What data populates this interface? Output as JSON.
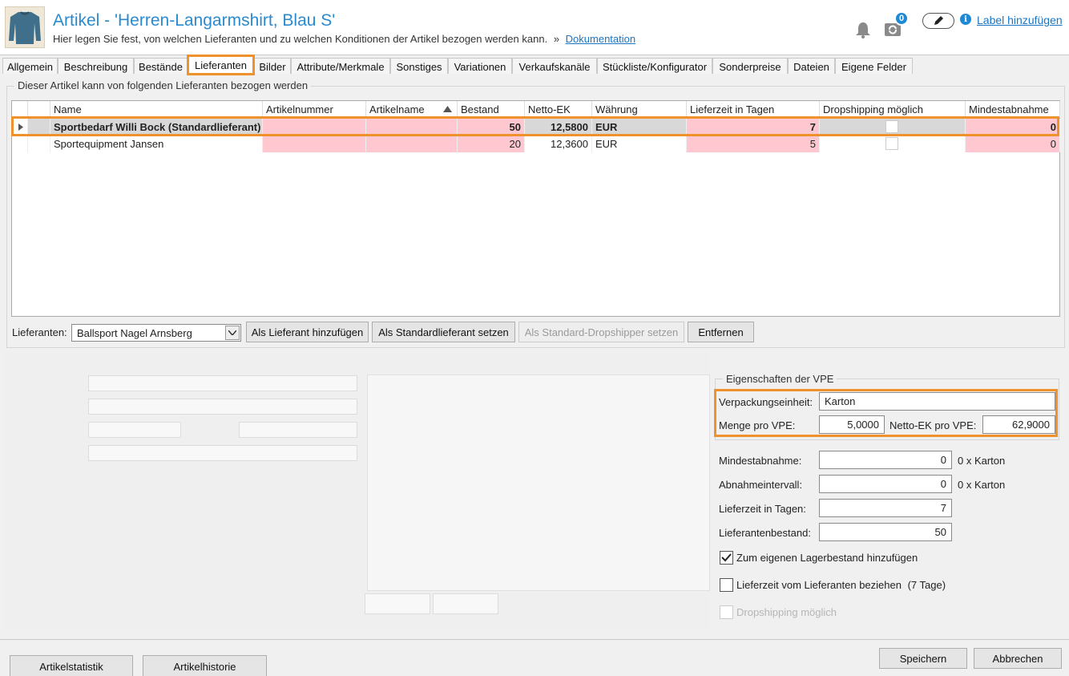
{
  "header": {
    "title": "Artikel - 'Herren-Langarmshirt, Blau S'",
    "subtitle": "Hier legen Sie fest, von welchen Lieferanten und zu welchen Konditionen der Artikel bezogen werden kann.",
    "separator": "»",
    "doc_link": "Dokumentation",
    "sync_count": "0",
    "label_link": "Label hinzufügen"
  },
  "tabs": [
    {
      "label": "Allgemein"
    },
    {
      "label": "Beschreibung"
    },
    {
      "label": "Bestände"
    },
    {
      "label": "Lieferanten"
    },
    {
      "label": "Bilder"
    },
    {
      "label": "Attribute/Merkmale"
    },
    {
      "label": "Sonstiges"
    },
    {
      "label": "Variationen"
    },
    {
      "label": "Verkaufskanäle"
    },
    {
      "label": "Stückliste/Konfigurator"
    },
    {
      "label": "Sonderpreise"
    },
    {
      "label": "Dateien"
    },
    {
      "label": "Eigene Felder"
    }
  ],
  "suppliers_group": {
    "title": "Dieser Artikel kann von folgenden Lieferanten bezogen werden",
    "columns": [
      "Name",
      "Artikelnummer",
      "Artikelname",
      "Bestand",
      "Netto-EK",
      "Währung",
      "Lieferzeit in Tagen",
      "Dropshipping möglich",
      "Mindestabnahme"
    ],
    "rows": [
      {
        "name": "Sportbedarf Willi Bock (Standardlieferant)",
        "artikelnummer": "",
        "artikelname": "",
        "bestand": "50",
        "netto_ek": "12,5800",
        "waehrung": "EUR",
        "lieferzeit": "7",
        "mindestabnahme": "0"
      },
      {
        "name": "Sportequipment Jansen",
        "artikelnummer": "",
        "artikelname": "",
        "bestand": "20",
        "netto_ek": "12,3600",
        "waehrung": "EUR",
        "lieferzeit": "5",
        "mindestabnahme": "0"
      }
    ],
    "supplier_label": "Lieferanten:",
    "supplier_selected": "Ballsport Nagel Arnsberg",
    "btn_add": "Als Lieferant hinzufügen",
    "btn_default": "Als Standardlieferant setzen",
    "btn_dropshipper": "Als Standard-Dropshipper setzen",
    "btn_remove": "Entfernen"
  },
  "vpe": {
    "title": "Eigenschaften der VPE",
    "unit_label": "Verpackungseinheit:",
    "unit_value": "Karton",
    "qty_label": "Menge pro VPE:",
    "qty_value": "5,0000",
    "ek_label": "Netto-EK pro VPE:",
    "ek_value": "62,9000"
  },
  "details": {
    "min_label": "Mindestabnahme:",
    "min_value": "0",
    "min_unit": "0 x Karton",
    "interval_label": "Abnahmeintervall:",
    "interval_value": "0",
    "interval_unit": "0 x Karton",
    "lead_label": "Lieferzeit in Tagen:",
    "lead_value": "7",
    "stock_label": "Lieferantenbestand:",
    "stock_value": "50",
    "chk_stock": "Zum eigenen Lagerbestand hinzufügen",
    "chk_stock_checked": true,
    "chk_lead": "Lieferzeit vom Lieferanten beziehen",
    "chk_lead_suffix": "(7 Tage)",
    "chk_drop": "Dropshipping möglich"
  },
  "footer": {
    "btn_stats": "Artikelstatistik",
    "btn_history": "Artikelhistorie",
    "btn_save": "Speichern",
    "btn_cancel": "Abbrechen"
  },
  "colors": {
    "accent": "#f0922b",
    "link": "#1a75c4",
    "pink_cell": "#ffc8d0"
  }
}
